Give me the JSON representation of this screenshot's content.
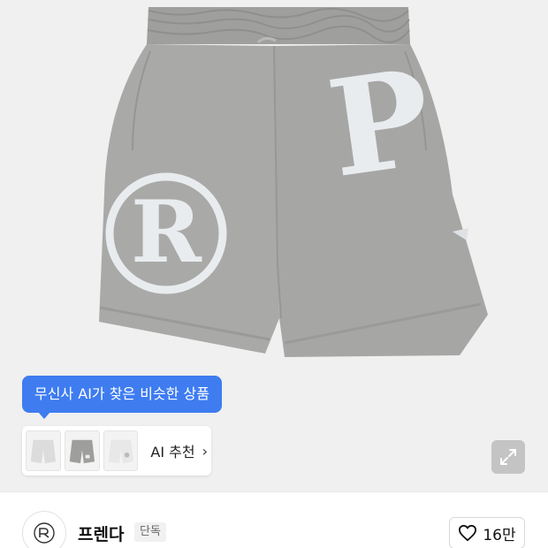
{
  "product": {
    "image": {
      "description_icon": "shorts-image",
      "logo_left": "R",
      "logo_right": "P"
    }
  },
  "ai_tooltip": {
    "text": "무신사 AI가 찾은 비슷한 상품"
  },
  "ai_recommendation": {
    "label": "AI 추천",
    "chevron_icon": "chevron-right-icon",
    "thumbnails": [
      {
        "name": "similar-product-1"
      },
      {
        "name": "similar-product-2"
      },
      {
        "name": "similar-product-3"
      }
    ]
  },
  "expand": {
    "icon": "expand-arrows-icon"
  },
  "brand": {
    "name": "프렌다",
    "badge": "단독",
    "logo_icon": "brand-logo-icon"
  },
  "like": {
    "icon": "heart-icon",
    "count": "16만"
  },
  "colors": {
    "accent_blue": "#3e7cf0",
    "shorts_gray": "#a7a8a6",
    "patch_white": "#e9ecef"
  }
}
